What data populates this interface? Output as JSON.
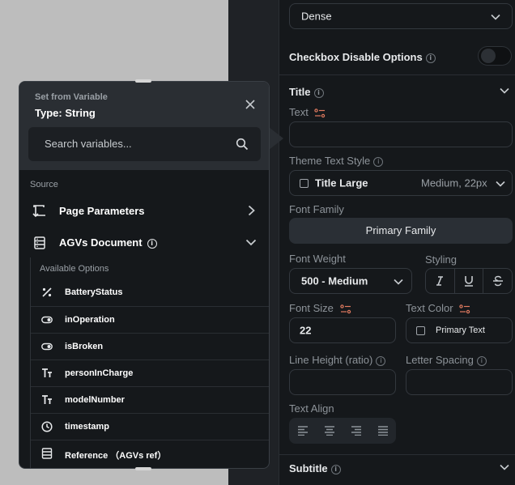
{
  "props": {
    "style_select": "Dense",
    "checkbox_disable": "Checkbox Disable Options",
    "title_section": "Title",
    "text_label": "Text",
    "theme_text_style_label": "Theme Text Style",
    "theme_text_style_value": "Title Large",
    "theme_text_style_meta": "Medium, 22px",
    "font_family_label": "Font Family",
    "font_family_value": "Primary Family",
    "font_weight_label": "Font Weight",
    "font_weight_value": "500 - Medium",
    "styling_label": "Styling",
    "font_size_label": "Font Size",
    "font_size_value": "22",
    "text_color_label": "Text Color",
    "text_color_value": "Primary Text",
    "line_height_label": "Line Height (ratio)",
    "letter_spacing_label": "Letter Spacing",
    "text_align_label": "Text Align",
    "subtitle_section": "Subtitle"
  },
  "popup": {
    "title": "Set from Variable",
    "type": "Type: String",
    "search_placeholder": "Search variables...",
    "source_label": "Source",
    "sources": [
      {
        "label": "Page Parameters",
        "icon": "page-params-icon"
      },
      {
        "label": "AGVs Document",
        "icon": "document-icon"
      }
    ],
    "available_label": "Available Options",
    "options": [
      {
        "label": "BatteryStatus",
        "icon": "percent-icon"
      },
      {
        "label": "inOperation",
        "icon": "toggle-icon"
      },
      {
        "label": "isBroken",
        "icon": "toggle-icon"
      },
      {
        "label": "personInCharge",
        "icon": "text-type-icon"
      },
      {
        "label": "modelNumber",
        "icon": "text-type-icon"
      },
      {
        "label": "timestamp",
        "icon": "clock-icon"
      },
      {
        "label": "Reference （AGVs ref）",
        "icon": "reference-icon"
      }
    ]
  },
  "colors": {
    "panel_bg": "#15181b",
    "popup_header": "#2a2e33",
    "accent_var": "#e07a5f"
  }
}
